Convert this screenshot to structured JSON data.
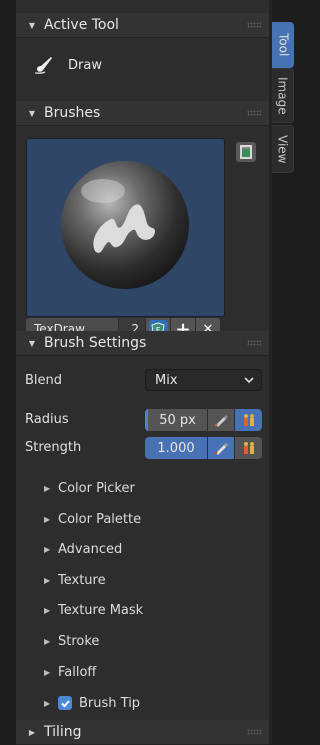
{
  "tabs": [
    "Tool",
    "Image",
    "View"
  ],
  "active_tool": {
    "header": "Active Tool",
    "tool_name": "Draw",
    "icon": "draw-brush-icon"
  },
  "brushes": {
    "header": "Brushes",
    "brush_name": "TexDraw",
    "user_count": "2",
    "preview_icon": "brush-preview-sphere",
    "fake_user_icon": "fake-user-shield-icon",
    "add_icon": "+",
    "remove_icon": "✕"
  },
  "brush_settings": {
    "header": "Brush Settings",
    "blend_label": "Blend",
    "blend_value": "Mix",
    "radius_label": "Radius",
    "radius_value": "50 px",
    "strength_label": "Strength",
    "strength_value": "1.000",
    "subpanels": [
      "Color Picker",
      "Color Palette",
      "Advanced",
      "Texture",
      "Texture Mask",
      "Stroke",
      "Falloff",
      "Brush Tip"
    ],
    "brush_tip_checked": true
  },
  "tiling": {
    "header": "Tiling"
  },
  "colors": {
    "accent": "#4772b3",
    "panel": "#2d2d2d",
    "header": "#333333",
    "preview_bg": "#2f4666"
  }
}
